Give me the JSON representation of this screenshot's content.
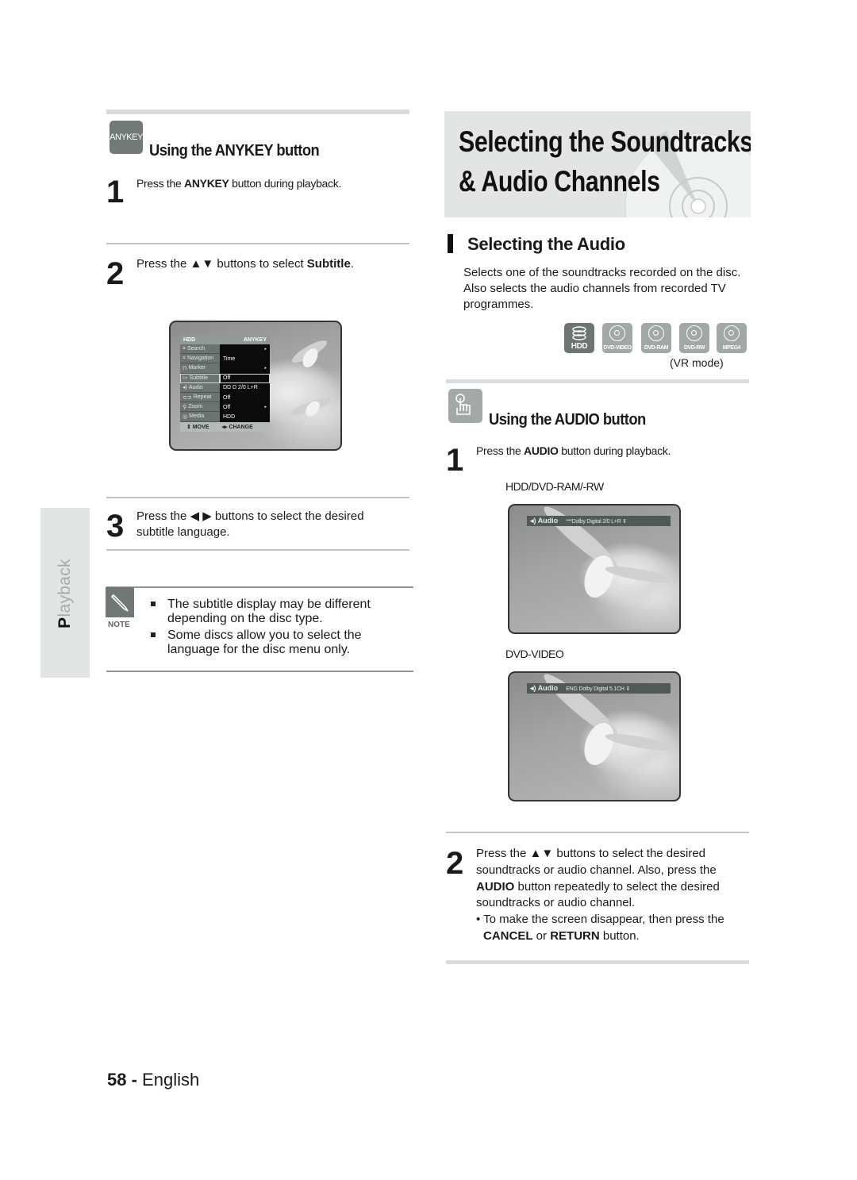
{
  "side_tab": {
    "first_letter": "P",
    "rest": "layback"
  },
  "left": {
    "anykey_section": {
      "icon_label": "ANYKEY",
      "heading": "Using the ANYKEY button"
    },
    "steps": [
      {
        "number": "1",
        "pre": "Press the ",
        "bold": "ANYKEY",
        "post": " button during playback."
      },
      {
        "number": "2",
        "pre": "Press the ▲▼ buttons to select ",
        "bold": "Subtitle",
        "post": "."
      },
      {
        "number": "3",
        "line1": "Press the ◀ ▶ buttons to select the desired",
        "line2": "subtitle  language."
      }
    ],
    "osd_menu": {
      "source": "HDD",
      "title": "ANYKEY",
      "rows": [
        {
          "label": "Search",
          "value": "",
          "arrow": "▸"
        },
        {
          "label": "Navigation",
          "value": "Time",
          "arrow": ""
        },
        {
          "label": "Marker",
          "value": "",
          "arrow": "▸"
        },
        {
          "label": "Subtitle",
          "value": "Off",
          "arrow": "",
          "selected": true
        },
        {
          "label": "Audio",
          "value": "DD D 2/0 L+R",
          "arrow": ""
        },
        {
          "label": "Repeat",
          "value": "Off",
          "arrow": ""
        },
        {
          "label": "Zoom",
          "value": "Off",
          "arrow": "▸"
        },
        {
          "label": "Media",
          "value": "HDD",
          "arrow": ""
        }
      ],
      "footer_move": "⇕ MOVE",
      "footer_change": "◂▸ CHANGE"
    },
    "note": {
      "label": "NOTE",
      "items": [
        {
          "line1": "The subtitle display may be different",
          "line2": "depending on the disc type."
        },
        {
          "line1": "Some discs allow you to select the",
          "line2": "language for the disc menu only."
        }
      ]
    }
  },
  "right": {
    "title_line1": "Selecting the Soundtracks",
    "title_line2": "& Audio Channels",
    "section_heading": "Selecting the Audio",
    "description": [
      "Selects one of the soundtracks recorded on the disc.",
      "Also selects the audio channels from recorded TV",
      "programmes."
    ],
    "disc_types": [
      "HDD",
      "DVD-VIDEO",
      "DVD-RAM",
      "DVD-RW",
      "MPEG4"
    ],
    "vr_mode_note": "(VR mode)",
    "audio_section": {
      "heading": "Using the AUDIO button"
    },
    "step1": {
      "number": "1",
      "pre": "Press the ",
      "bold": "AUDIO",
      "post": " button during playback."
    },
    "screens": [
      {
        "caption": "HDD/DVD-RAM/-RW",
        "osd_label": "Audio",
        "osd_value": "***Dolby Digital   2/0 L+R  ⇕"
      },
      {
        "caption": "DVD-VIDEO",
        "osd_label": "Audio",
        "osd_value": "ENG  Dolby Digital   5.1CH ⇕"
      }
    ],
    "step2": {
      "number": "2",
      "line1": "Press the ▲▼ buttons to select the desired",
      "line2": "soundtracks or audio channel. Also, press the",
      "line3_bold": "AUDIO",
      "line3_rest": " button repeatedly to select the desired",
      "line4": "soundtracks or audio channel.",
      "bullet_line1": "• To make the screen disappear, then press the",
      "bullet_bold1": "CANCEL",
      "bullet_mid": " or ",
      "bullet_bold2": "RETURN",
      "bullet_end": " button."
    }
  },
  "footer": {
    "page_number": "58",
    "separator": " - ",
    "language": "English"
  }
}
